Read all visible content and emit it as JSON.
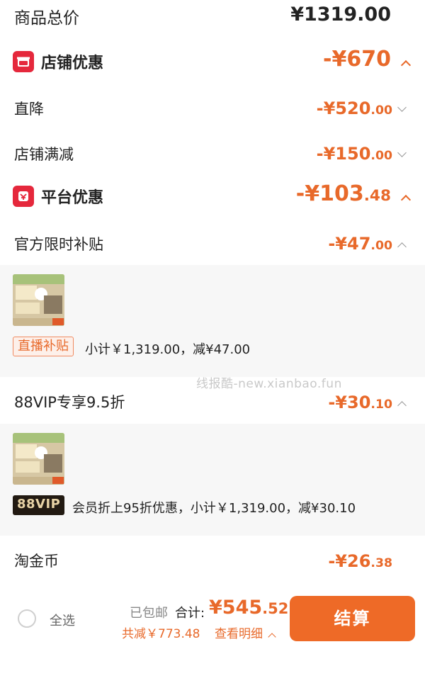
{
  "goods_total": {
    "label": "商品总价",
    "amount": "¥1319.00"
  },
  "shop_discount": {
    "title": "店铺优惠",
    "amount": "-¥670",
    "icon": "store-icon"
  },
  "direct_cut": {
    "label": "直降",
    "amount_int": "-¥520",
    "amount_dec": ".00"
  },
  "shop_full_cut": {
    "label": "店铺满减",
    "amount_int": "-¥150",
    "amount_dec": ".00"
  },
  "platform_discount": {
    "title": "平台优惠",
    "amount_int": "-¥103",
    "amount_dec": ".48",
    "icon": "platform-icon"
  },
  "official_subsidy": {
    "label": "官方限时补贴",
    "amount_int": "-¥47",
    "amount_dec": ".00",
    "tag": "直播补贴",
    "detail": "小计￥1,319.00，减¥47.00"
  },
  "vip_discount": {
    "label": "88VIP专享9.5折",
    "amount_int": "-¥30",
    "amount_dec": ".10",
    "tag": "88VIP",
    "detail": "会员折上95折优惠，小计￥1,319.00，减¥30.10"
  },
  "taojinbi": {
    "label": "淘金币",
    "amount_int": "-¥26",
    "amount_dec": ".38"
  },
  "watermark": "线报酷-new.xianbao.fun",
  "bottom_bar": {
    "select_all": "全选",
    "shipping": "已包邮",
    "total_label": "合计:",
    "total_int": "¥545",
    "total_dec": ".52",
    "saved": "共减￥773.48",
    "view_detail": "查看明细",
    "checkout": "结算"
  },
  "colors": {
    "accent": "#e8692a",
    "checkout_bg": "#ee6a27",
    "icon_red": "#e5283c"
  }
}
